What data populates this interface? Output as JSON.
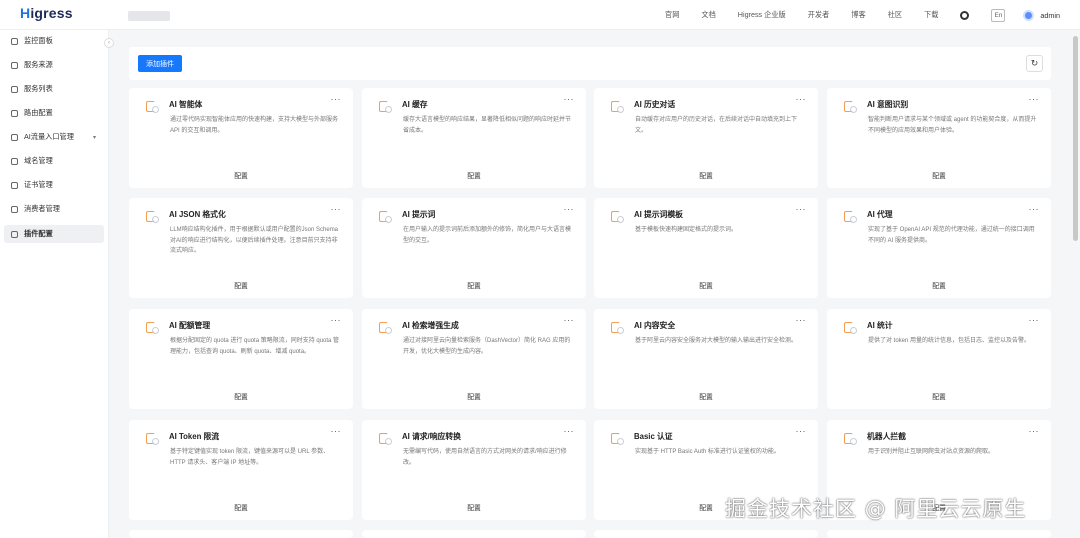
{
  "header": {
    "logo": "Higress",
    "nav": [
      "官网",
      "文档",
      "Higress 企业版",
      "开发者",
      "博客",
      "社区",
      "下载"
    ],
    "lang_button": "En",
    "user": "admin"
  },
  "sidebar": {
    "items": [
      {
        "label": "监控面板",
        "icon": "dashboard-icon"
      },
      {
        "label": "服务来源",
        "icon": "source-icon"
      },
      {
        "label": "服务列表",
        "icon": "list-icon"
      },
      {
        "label": "路由配置",
        "icon": "route-icon"
      },
      {
        "label": "AI流量入口管理",
        "icon": "ai-gateway-icon",
        "expandable": true
      },
      {
        "label": "域名管理",
        "icon": "globe-icon"
      },
      {
        "label": "证书管理",
        "icon": "certificate-icon"
      },
      {
        "label": "消费者管理",
        "icon": "user-icon"
      },
      {
        "label": "插件配置",
        "icon": "plugin-icon",
        "active": true
      }
    ]
  },
  "toolbar": {
    "add_label": "添加插件"
  },
  "cards": [
    {
      "title": "AI 智能体",
      "desc": "通过零代码实现智能体应用的快速构建，支持大模型与外部服务 API 的交互和调用。",
      "cfg": "配置"
    },
    {
      "title": "AI 缓存",
      "desc": "缓存大语言模型的响应结果，显著降低相似问题的响应时延并节省成本。",
      "cfg": "配置"
    },
    {
      "title": "AI 历史对话",
      "desc": "自动缓存对应用户的历史对话，在后续对话中自动填充到上下文。",
      "cfg": "配置"
    },
    {
      "title": "AI 意图识别",
      "desc": "智能判断用户请求与某个领域或 agent 的功能契合度，从而提升不同模型的应用效果和用户体验。",
      "cfg": "配置"
    },
    {
      "title": "AI JSON 格式化",
      "desc": "LLM响应结构化插件，用于根据默认或用户配置的Json Schema对AI的响应进行结构化，以便后续插件处理。注意目前只支持非流式响应。",
      "cfg": "配置"
    },
    {
      "title": "AI 提示词",
      "desc": "在用户输入的提示词前后添加额外的修饰，简化用户与大语言模型的交互。",
      "cfg": "配置"
    },
    {
      "title": "AI 提示词模板",
      "desc": "基于模板快速构建固定格式的提示词。",
      "cfg": "配置"
    },
    {
      "title": "AI 代理",
      "desc": "实现了基于 OpenAI API 规范的代理功能，通过统一的接口调用不同的 AI 服务提供商。",
      "cfg": "配置"
    },
    {
      "title": "AI 配额管理",
      "desc": "根据分配固定的 quota 进行 quota 策略限流，同时支持 quota 管理能力，包括查询 quota、刷新 quota、增减 quota。",
      "cfg": "配置"
    },
    {
      "title": "AI 检索增强生成",
      "desc": "通过对接阿里云向量检索服务（DashVector）简化 RAG 应用的开发，优化大模型的生成内容。",
      "cfg": "配置"
    },
    {
      "title": "AI 内容安全",
      "desc": "基于阿里云内容安全服务对大模型的输入输出进行安全检测。",
      "cfg": "配置"
    },
    {
      "title": "AI 统计",
      "desc": "提供了对 token 用量的统计信息，包括日志、监控以及告警。",
      "cfg": "配置"
    },
    {
      "title": "AI Token 限流",
      "desc": "基于特定键值实现 token 限流，键值来源可以是 URL 参数、HTTP 请求头、客户端 IP 地址等。",
      "cfg": "配置"
    },
    {
      "title": "AI 请求/响应转换",
      "desc": "无需编写代码，使用自然语言的方式对网关的请求/响应进行修改。",
      "cfg": "配置"
    },
    {
      "title": "Basic 认证",
      "desc": "实现基于 HTTP Basic Auth 标准进行认证鉴权的功能。",
      "cfg": "配置"
    },
    {
      "title": "机器人拦截",
      "desc": "用于识别并阻止互联网爬虫对站点资源的爬取。",
      "cfg": "配置"
    }
  ],
  "watermark": "掘金技术社区 @ 阿里云云原生"
}
